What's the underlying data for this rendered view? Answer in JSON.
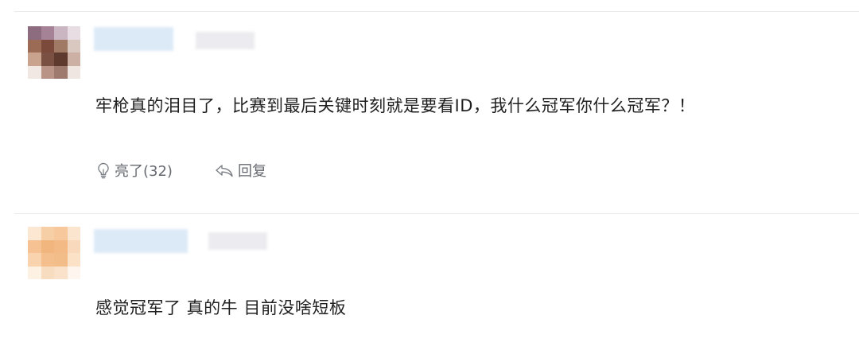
{
  "comments": [
    {
      "avatar_colors": [
        "#8d6c80",
        "#a68297",
        "#c9b6c2",
        "#e8dde3",
        "#9c6b56",
        "#7b4a3a",
        "#a07a64",
        "#d9c8c0",
        "#c9a38e",
        "#7a5043",
        "#5e3a2e",
        "#cbb0a3",
        "#f1e7e3",
        "#b99486",
        "#9e7a6e",
        "#efe6e2"
      ],
      "text": "牢枪真的泪目了，比赛到最后关键时刻就是要看ID，我什么冠军你什么冠军？！",
      "like_label": "亮了(32)",
      "reply_label": "回复"
    },
    {
      "avatar_colors": [
        "#fbe7d2",
        "#f7cfa6",
        "#f6c89b",
        "#fbe5cf",
        "#f6c293",
        "#f1b57e",
        "#f3ba85",
        "#f8d9bb",
        "#f8d3ae",
        "#f4bf8d",
        "#f3bd8a",
        "#fbe1c6",
        "#fdf1e4",
        "#f8dcc0",
        "#f9e2c9",
        "#fef6ee"
      ],
      "text": "感觉冠军了  真的牛  目前没啥短板"
    }
  ],
  "colors": {
    "text": "#1f1f1f",
    "action_text": "#666a70",
    "divider": "#e9e9ec",
    "name_blur": "#dceaf7",
    "meta_blur": "#ececf0"
  },
  "icons": {
    "like": "lightbulb-icon",
    "reply": "reply-arrow-icon"
  }
}
